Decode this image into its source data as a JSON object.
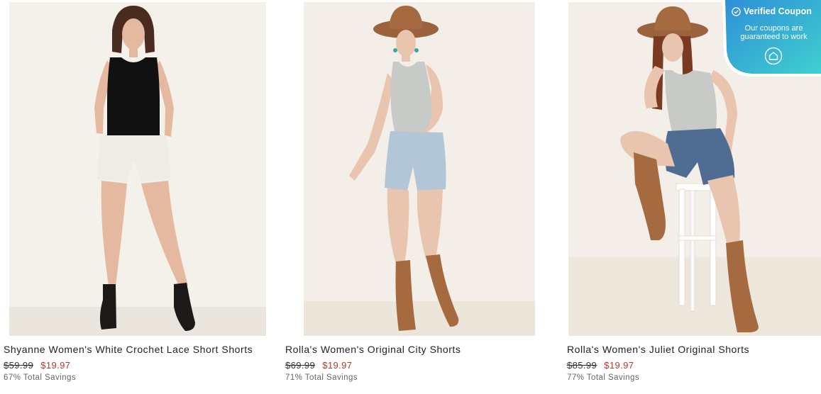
{
  "products": [
    {
      "name": "Shyanne Women's White Crochet Lace Short Shorts",
      "original_price": "$59.99",
      "sale_price": "$19.97",
      "savings": "67% Total Savings",
      "top_color": "#111111",
      "shorts_color": "#efece6",
      "boot_color": "#1c1a18"
    },
    {
      "name": "Rolla's Women's Original City Shorts",
      "original_price": "$69.99",
      "sale_price": "$19.97",
      "savings": "71% Total Savings",
      "top_color": "#c8cac8",
      "shorts_color": "#b3c6d8",
      "boot_color": "#a56a40"
    },
    {
      "name": "Rolla's Women's Juliet Original Shorts",
      "original_price": "$85.99",
      "sale_price": "$19.97",
      "savings": "77% Total Savings",
      "top_color": "#c8cac8",
      "shorts_color": "#4f6c92",
      "boot_color": "#a56a40"
    }
  ],
  "coupon": {
    "title": "Verified Coupon",
    "message": "Our coupons are guaranteed to work",
    "icon": "home-icon",
    "gradient_start": "#2f8fd8",
    "gradient_end": "#3fd0cf"
  },
  "colors": {
    "sale_price": "#b23a29",
    "image_background": "#f3efe8"
  }
}
